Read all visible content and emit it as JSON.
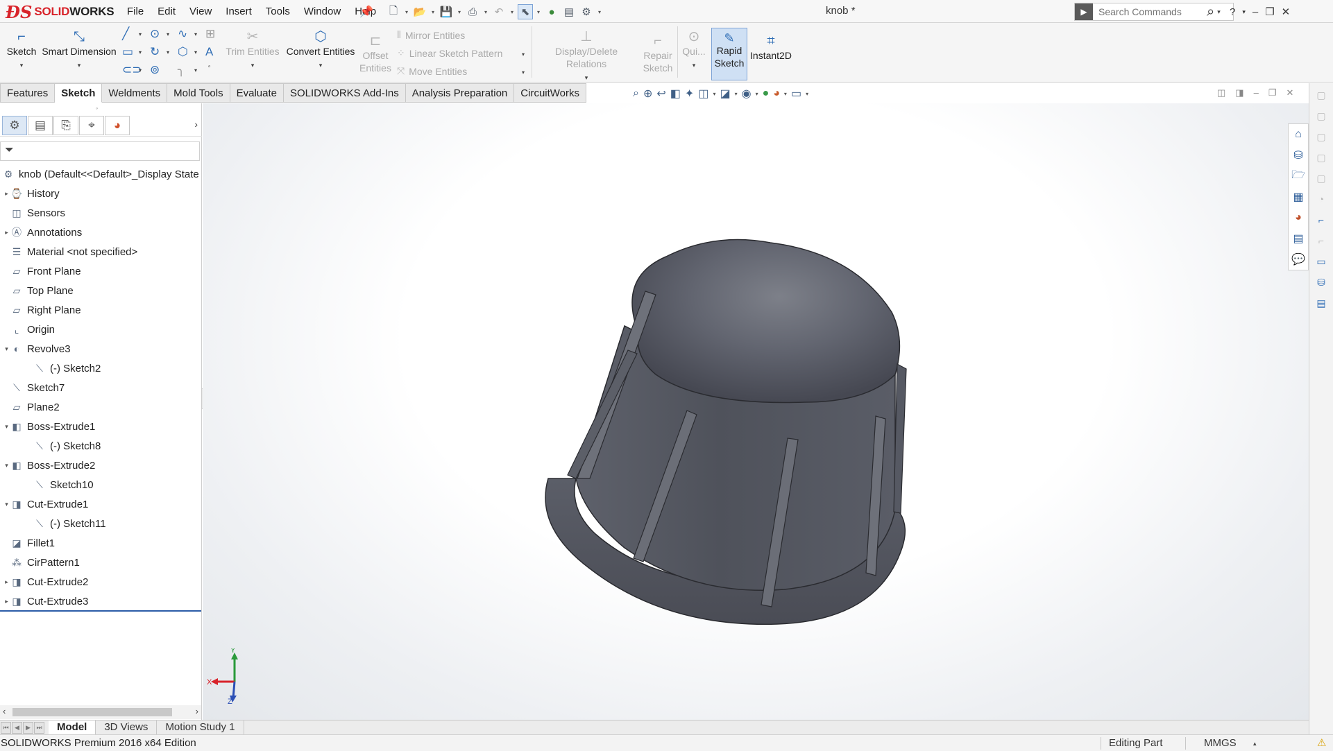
{
  "app": {
    "brand_ds": "ƉS",
    "brand_solid": "SOLID",
    "brand_works": "WORKS",
    "document_title": "knob *"
  },
  "menu": [
    "File",
    "Edit",
    "View",
    "Insert",
    "Tools",
    "Window",
    "Help"
  ],
  "search": {
    "placeholder": "Search Commands"
  },
  "window_controls": {
    "help": "?",
    "minimize": "–",
    "restore": "❐",
    "close": "✕"
  },
  "command_manager": {
    "sketch": "Sketch",
    "smart_dimension": "Smart Dimension",
    "trim_entities": "Trim Entities",
    "convert_entities": "Convert Entities",
    "offset_line1": "Offset",
    "offset_line2": "Entities",
    "mirror_entities": "Mirror Entities",
    "linear_sketch_pattern": "Linear Sketch Pattern",
    "move_entities": "Move Entities",
    "display_delete_relations": "Display/Delete Relations",
    "repair_line1": "Repair",
    "repair_line2": "Sketch",
    "quick_snaps": "Qui...",
    "rapid_line1": "Rapid",
    "rapid_line2": "Sketch",
    "instant2d": "Instant2D"
  },
  "tabs": [
    "Features",
    "Sketch",
    "Weldments",
    "Mold Tools",
    "Evaluate",
    "SOLIDWORKS Add-Ins",
    "Analysis Preparation",
    "CircuitWorks"
  ],
  "active_tab": "Sketch",
  "feature_tree": {
    "root": "knob  (Default<<Default>_Display State",
    "nodes": [
      {
        "label": "History",
        "icon": "history-icon",
        "level": 0,
        "expander": "▸"
      },
      {
        "label": "Sensors",
        "icon": "sensors-icon",
        "level": 0,
        "expander": ""
      },
      {
        "label": "Annotations",
        "icon": "annotations-icon",
        "level": 0,
        "expander": "▸"
      },
      {
        "label": "Material <not specified>",
        "icon": "material-icon",
        "level": 0,
        "expander": ""
      },
      {
        "label": "Front Plane",
        "icon": "plane-icon",
        "level": 0,
        "expander": ""
      },
      {
        "label": "Top Plane",
        "icon": "plane-icon",
        "level": 0,
        "expander": ""
      },
      {
        "label": "Right Plane",
        "icon": "plane-icon",
        "level": 0,
        "expander": ""
      },
      {
        "label": "Origin",
        "icon": "origin-icon",
        "level": 0,
        "expander": ""
      },
      {
        "label": "Revolve3",
        "icon": "revolve-icon",
        "level": 0,
        "expander": "▾"
      },
      {
        "label": "(-) Sketch2",
        "icon": "sketch-icon",
        "level": 1,
        "expander": ""
      },
      {
        "label": "Sketch7",
        "icon": "sketch-icon",
        "level": 0,
        "expander": ""
      },
      {
        "label": "Plane2",
        "icon": "plane-icon",
        "level": 0,
        "expander": ""
      },
      {
        "label": "Boss-Extrude1",
        "icon": "extrude-icon",
        "level": 0,
        "expander": "▾"
      },
      {
        "label": "(-) Sketch8",
        "icon": "sketch-icon",
        "level": 1,
        "expander": ""
      },
      {
        "label": "Boss-Extrude2",
        "icon": "extrude-icon",
        "level": 0,
        "expander": "▾"
      },
      {
        "label": "Sketch10",
        "icon": "sketch-icon",
        "level": 1,
        "expander": ""
      },
      {
        "label": "Cut-Extrude1",
        "icon": "cut-extrude-icon",
        "level": 0,
        "expander": "▾"
      },
      {
        "label": "(-) Sketch11",
        "icon": "sketch-icon",
        "level": 1,
        "expander": ""
      },
      {
        "label": "Fillet1",
        "icon": "fillet-icon",
        "level": 0,
        "expander": ""
      },
      {
        "label": "CirPattern1",
        "icon": "circular-pattern-icon",
        "level": 0,
        "expander": ""
      },
      {
        "label": "Cut-Extrude2",
        "icon": "cut-extrude-icon",
        "level": 0,
        "expander": "▸"
      },
      {
        "label": "Cut-Extrude3",
        "icon": "cut-extrude-icon",
        "level": 0,
        "expander": "▸"
      }
    ]
  },
  "triad": {
    "x": "X",
    "y": "Y",
    "z": "Z"
  },
  "bottom_tabs": [
    "Model",
    "3D Views",
    "Motion Study 1"
  ],
  "active_bottom_tab": "Model",
  "status": {
    "edition": "SOLIDWORKS Premium 2016 x64 Edition",
    "mode": "Editing Part",
    "units": "MMGS"
  },
  "colors": {
    "brand_red": "#d8232a",
    "model_gray": "#5b5d66",
    "accent_blue": "#2f6db5",
    "active_tool_bg": "#cfe0f4"
  }
}
